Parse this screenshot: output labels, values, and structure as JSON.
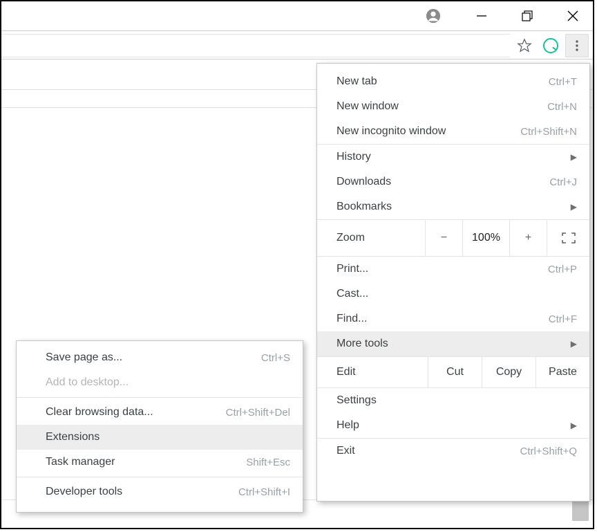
{
  "menu": {
    "new_tab": {
      "label": "New tab",
      "shortcut": "Ctrl+T"
    },
    "new_window": {
      "label": "New window",
      "shortcut": "Ctrl+N"
    },
    "incognito": {
      "label": "New incognito window",
      "shortcut": "Ctrl+Shift+N"
    },
    "history": {
      "label": "History"
    },
    "downloads": {
      "label": "Downloads",
      "shortcut": "Ctrl+J"
    },
    "bookmarks": {
      "label": "Bookmarks"
    },
    "zoom": {
      "label": "Zoom",
      "minus": "−",
      "value": "100%",
      "plus": "+"
    },
    "print": {
      "label": "Print...",
      "shortcut": "Ctrl+P"
    },
    "cast": {
      "label": "Cast..."
    },
    "find": {
      "label": "Find...",
      "shortcut": "Ctrl+F"
    },
    "more_tools": {
      "label": "More tools"
    },
    "edit": {
      "label": "Edit",
      "cut": "Cut",
      "copy": "Copy",
      "paste": "Paste"
    },
    "settings": {
      "label": "Settings"
    },
    "help": {
      "label": "Help"
    },
    "exit": {
      "label": "Exit",
      "shortcut": "Ctrl+Shift+Q"
    }
  },
  "submenu": {
    "save_as": {
      "label": "Save page as...",
      "shortcut": "Ctrl+S"
    },
    "add_desktop": {
      "label": "Add to desktop..."
    },
    "clear_data": {
      "label": "Clear browsing data...",
      "shortcut": "Ctrl+Shift+Del"
    },
    "extensions": {
      "label": "Extensions"
    },
    "task_manager": {
      "label": "Task manager",
      "shortcut": "Shift+Esc"
    },
    "dev_tools": {
      "label": "Developer tools",
      "shortcut": "Ctrl+Shift+I"
    }
  }
}
